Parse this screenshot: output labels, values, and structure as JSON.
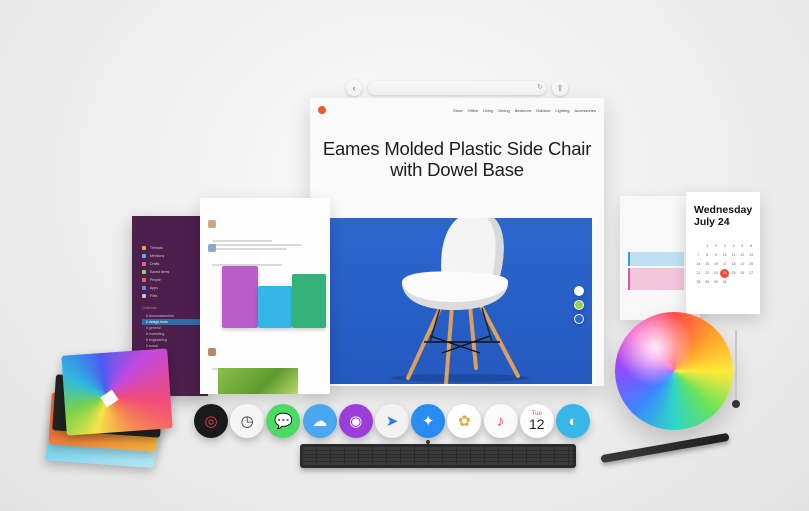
{
  "safari": {
    "url": "",
    "site_nav": [
      "Store",
      "Office",
      "Living",
      "Dining",
      "Bedroom",
      "Outdoor",
      "Lighting",
      "Accessories"
    ],
    "headline_line1": "Eames Molded Plastic Side Chair",
    "headline_line2": "with Dowel Base",
    "hero_color": "#2c66cf",
    "color_options": [
      "#ffffff",
      "#9bd14a",
      "#2c66cf"
    ]
  },
  "slack": {
    "channels": [
      "Threads",
      "Mentions",
      "Drafts",
      "Saved items",
      "People",
      "Apps",
      "Files"
    ],
    "section_label": "Channels",
    "channel_list": [
      "announcements",
      "design-team",
      "general",
      "marketing",
      "engineering",
      "social"
    ],
    "dm_label": "Direct messages"
  },
  "calendar": {
    "weekday": "Wednesday",
    "date": "July 24",
    "today": "24",
    "days": [
      "1",
      "2",
      "3",
      "4",
      "5",
      "6",
      "7",
      "8",
      "9",
      "10",
      "11",
      "12",
      "13",
      "14",
      "15",
      "16",
      "17",
      "18",
      "19",
      "20",
      "21",
      "22",
      "23",
      "24",
      "25",
      "26",
      "27",
      "28",
      "29",
      "30",
      "31"
    ]
  },
  "dock": {
    "items": [
      {
        "name": "activity-icon",
        "color": "#1a1a1a"
      },
      {
        "name": "clock-icon",
        "color": "#f5f5f5"
      },
      {
        "name": "messages-icon",
        "color": "#4cd964"
      },
      {
        "name": "weather-icon",
        "color": "#4aa8f0"
      },
      {
        "name": "podcasts-icon",
        "color": "#9b3ed9"
      },
      {
        "name": "maps-icon",
        "color": "#f2f2f2"
      },
      {
        "name": "safari-icon",
        "color": "#2a8cf0"
      },
      {
        "name": "photos-icon",
        "color": "#ffffff"
      },
      {
        "name": "music-icon",
        "color": "#fafafa"
      },
      {
        "name": "calendar-icon",
        "color": "#ffffff"
      },
      {
        "name": "finder-icon",
        "color": "#38b6e8"
      }
    ],
    "calendar_day": "Tue",
    "calendar_num": "12"
  }
}
